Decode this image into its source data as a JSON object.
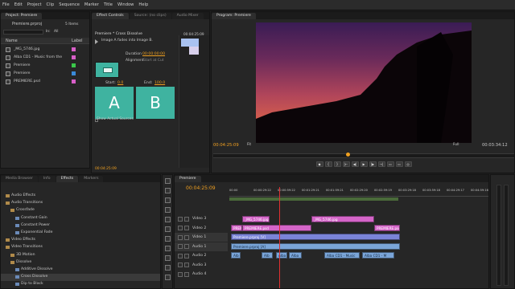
{
  "window": {
    "app_icon": "premiere-icon",
    "title": "Adobe Premiere Pro",
    "controls": [
      "minimize-icon",
      "maximize-icon",
      "close-icon"
    ]
  },
  "menu": [
    "File",
    "Edit",
    "Project",
    "Clip",
    "Sequence",
    "Marker",
    "Title",
    "Window",
    "Help"
  ],
  "project": {
    "tab": "Project: Premiere",
    "file": "Premiere.prproj",
    "count": "5 Items",
    "in_label": "In:",
    "in_value": "All",
    "col_name": "Name",
    "col_label": "Label",
    "items": [
      {
        "name": "_MG_5746.jpg",
        "color": "#d85fc8"
      },
      {
        "name": "Alba CD1 - Music from the",
        "color": "#d85fc8"
      },
      {
        "name": "Premiere",
        "color": "#3ac84a"
      },
      {
        "name": "Premiere",
        "color": "#3a8ad8"
      },
      {
        "name": "PREMIERE.psd",
        "color": "#d85fc8"
      }
    ]
  },
  "effect_controls": {
    "tabs": [
      "Effect Controls",
      "Source: (no clips)",
      "Audio Mixer"
    ],
    "title": "Premiere * Cross Dissolve",
    "description": "Image A fades into Image B.",
    "time": "00:04:25:09",
    "duration_label": "Duration",
    "duration": "00:00:00:00",
    "alignment_label": "Alignment",
    "alignment": "Start at Cut",
    "start_label": "Start:",
    "start_value": "0.0",
    "end_label": "End:",
    "end_value": "100.0",
    "a": "A",
    "b": "B",
    "show_sources": "Show Actual Sources",
    "bottom_time": "00:04:25:09"
  },
  "program": {
    "tab": "Program: Premiere",
    "timecode": "00:04:25:09",
    "fit": "Fit",
    "quality": "Full",
    "duration": "00:03:34:12"
  },
  "effects": {
    "tabs": [
      "Media Browser",
      "Info",
      "Effects",
      "Markers"
    ],
    "items": [
      {
        "label": "Audio Effects",
        "indent": 0
      },
      {
        "label": "Audio Transitions",
        "indent": 0
      },
      {
        "label": "Crossfade",
        "indent": 1
      },
      {
        "label": "Constant Gain",
        "indent": 2
      },
      {
        "label": "Constant Power",
        "indent": 2
      },
      {
        "label": "Exponential Fade",
        "indent": 2
      },
      {
        "label": "Video Effects",
        "indent": 0
      },
      {
        "label": "Video Transitions",
        "indent": 0
      },
      {
        "label": "3D Motion",
        "indent": 1
      },
      {
        "label": "Dissolve",
        "indent": 1
      },
      {
        "label": "Additive Dissolve",
        "indent": 2
      },
      {
        "label": "Cross Dissolve",
        "indent": 2
      },
      {
        "label": "Dip to Black",
        "indent": 2
      }
    ]
  },
  "timeline": {
    "tab": "Premiere",
    "timecode": "00:04:25:09",
    "ruler": [
      "00:00",
      "00:00:29:22",
      "00:00:59:22",
      "00:01:29:21",
      "00:01:59:21",
      "00:02:29:20",
      "00:02:59:19",
      "00:03:29:18",
      "00:03:59:18",
      "00:04:29:17",
      "00:04:59:16"
    ],
    "tracks": [
      {
        "label": "Video 3",
        "type": "video"
      },
      {
        "label": "Video 2",
        "type": "video"
      },
      {
        "label": "Video 1",
        "type": "video"
      },
      {
        "label": "Audio 1",
        "type": "audio"
      },
      {
        "label": "Audio 2",
        "type": "audio"
      },
      {
        "label": "Audio 3",
        "type": "audio"
      },
      {
        "label": "Audio 4",
        "type": "audio"
      }
    ],
    "clips": {
      "v3a": "_MG_5746.jpg",
      "v3b": "_MG_5746.jpg",
      "v2a": "PREMI",
      "v2b": "PREMIERE.psd",
      "v2c": "PREMIERE.psd",
      "v1": "Premiere.prproj [V]",
      "a1": "Premiere.prproj [A]",
      "a2a": "Alb",
      "a2b": "Alb",
      "a2c": "Alba",
      "a2d": "Alba",
      "a2e": "Alba CD1 - Music",
      "a2f": "Alba CD1 - M"
    }
  },
  "tools": [
    "selection-tool-icon",
    "track-select-icon",
    "ripple-edit-icon",
    "rolling-edit-icon",
    "rate-stretch-icon",
    "razor-icon",
    "slip-icon",
    "slide-icon",
    "pen-icon",
    "hand-icon",
    "zoom-icon"
  ]
}
